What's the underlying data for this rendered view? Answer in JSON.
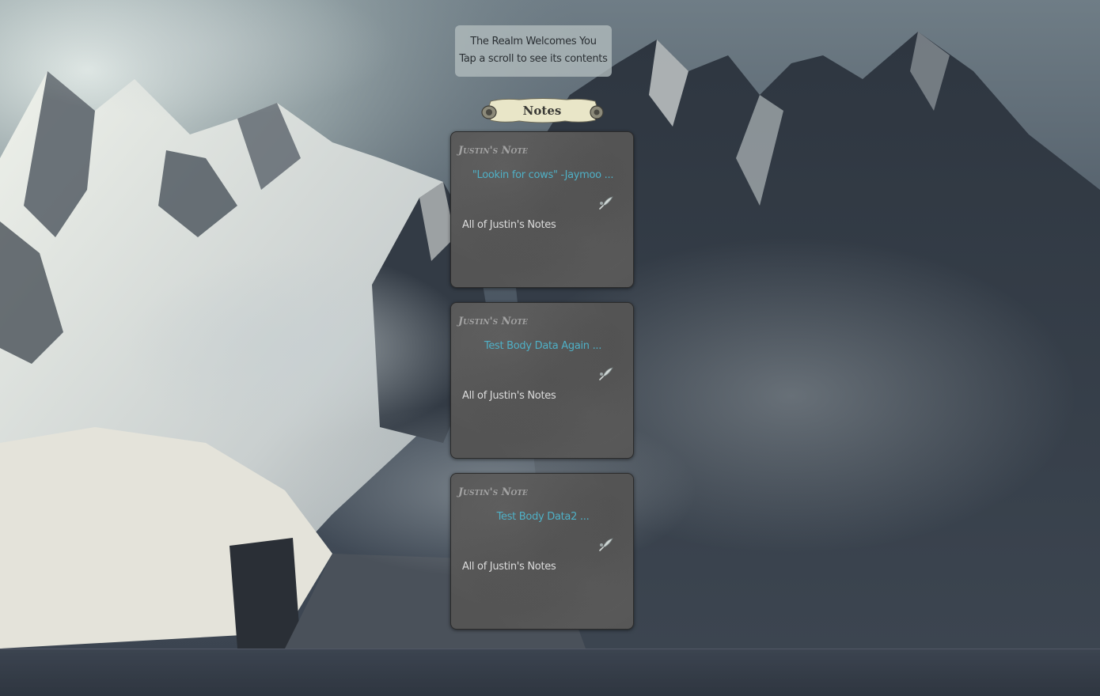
{
  "welcome": {
    "line1": "The Realm Welcomes You",
    "line2": "Tap a scroll to see its contents"
  },
  "banner": {
    "title": "Notes"
  },
  "notes": [
    {
      "title": "Justin's Note",
      "body": "\"Lookin for cows\" -Jaymoo ...",
      "link": "All of Justin's Notes",
      "icon": "quill-icon"
    },
    {
      "title": "Justin's Note",
      "body": "Test Body Data Again ...",
      "link": "All of Justin's Notes",
      "icon": "quill-icon"
    },
    {
      "title": "Justin's Note",
      "body": "Test Body Data2 ...",
      "link": "All of Justin's Notes",
      "icon": "quill-icon"
    }
  ],
  "colors": {
    "note_body_text": "#4fb0c6",
    "note_title_text": "#a3a3a3",
    "card_background": "#545454",
    "banner_parchment": "#e9e6c8"
  }
}
